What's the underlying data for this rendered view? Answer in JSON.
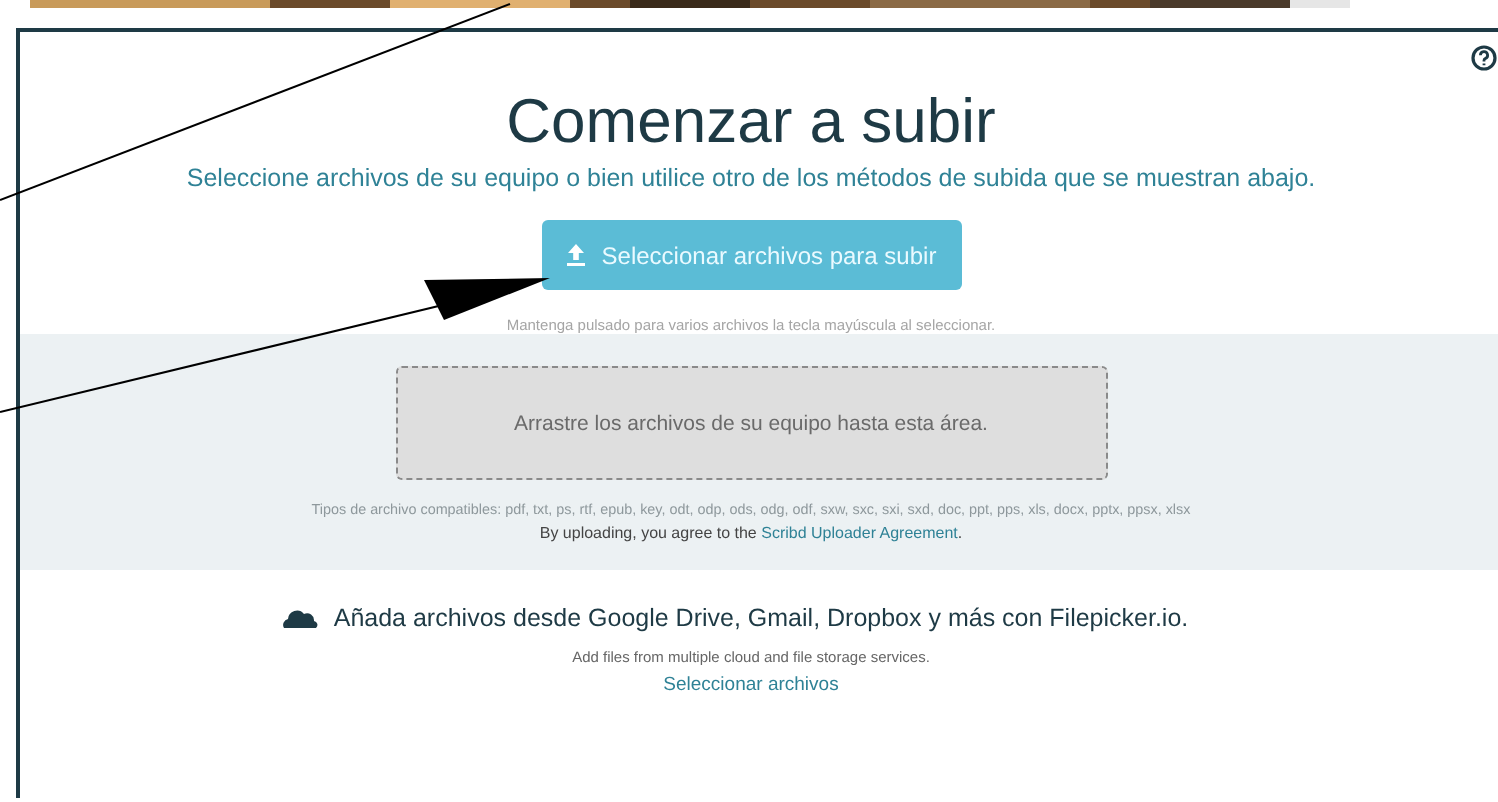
{
  "header": {
    "title": "Comenzar a subir",
    "subtitle": "Seleccione archivos de su equipo o bien utilice otro de los métodos de subida que se muestran abajo."
  },
  "upload_button": {
    "label": "Seleccionar archivos para subir"
  },
  "hint": "Mantenga pulsado para varios archivos la tecla mayúscula al seleccionar.",
  "drop_zone": {
    "label": "Arrastre los archivos de su equipo hasta esta área.",
    "file_types": "Tipos de archivo compatibles: pdf, txt, ps, rtf, epub, key, odt, odp, ods, odg, odf, sxw, sxc, sxi, sxd, doc, ppt, pps, xls, docx, pptx, ppsx, xlsx",
    "agreement_prefix": "By uploading, you agree to the",
    "agreement_link": "Scribd Uploader Agreement",
    "agreement_suffix": "."
  },
  "cloud": {
    "title": "Añada archivos desde Google Drive, Gmail, Dropbox y más con Filepicker.io.",
    "description": "Add files from multiple cloud and file storage services.",
    "link": "Seleccionar archivos"
  }
}
